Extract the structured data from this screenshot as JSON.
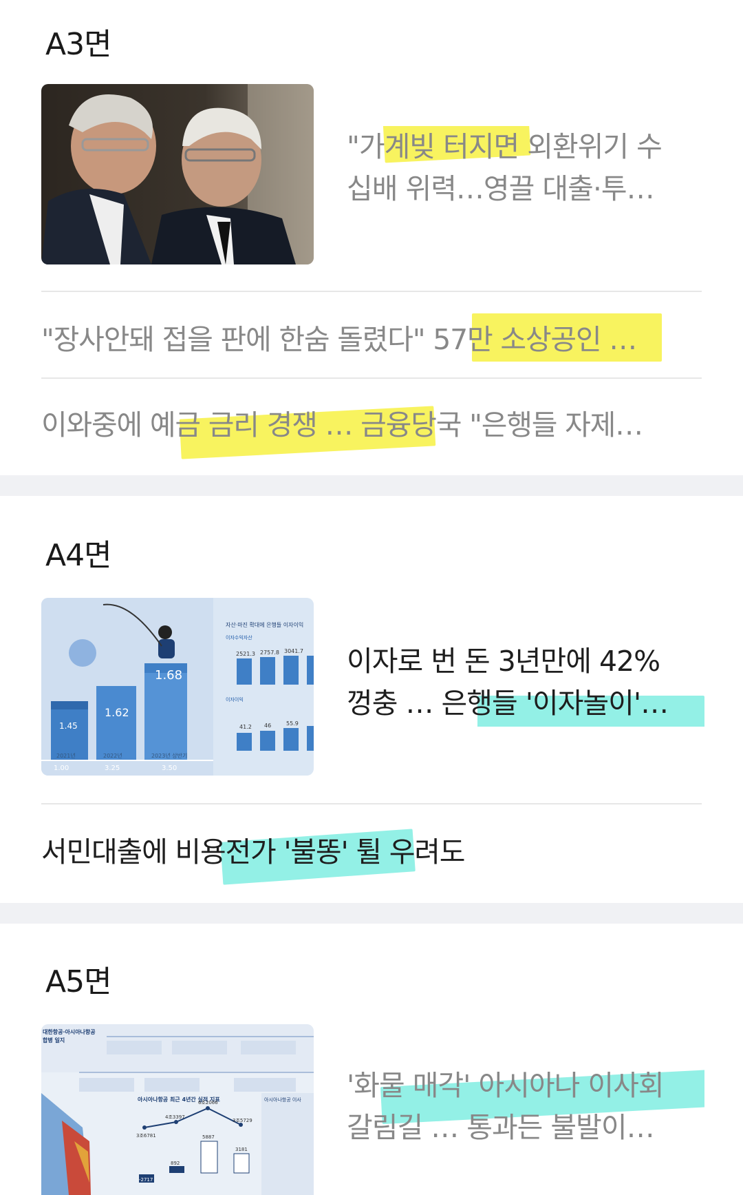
{
  "sections": [
    {
      "title": "A3면",
      "feature": {
        "headline": "\"가계빚 터지면 외환위기 수십배 위력…영끌 대출·투…",
        "line1": "\"가계빚 터지면 외환위기 수",
        "line2": "십배 위력…영끌 대출·투…"
      },
      "items": [
        "\"장사안돼 접을 판에 한숨 돌렸다\" 57만 소상공인 …",
        "이와중에 예금 금리 경쟁 … 금융당국 \"은행들 자제…"
      ]
    },
    {
      "title": "A4면",
      "feature": {
        "line1": "이자로 번 돈 3년만에 42%",
        "line2": "껑충 … 은행들 '이자놀이'…",
        "infographic": {
          "title": "자산·마진 확대에 은행들 이자이익",
          "left_labels": [
            "1.45",
            "1.62",
            "1.68"
          ],
          "bottom_labels": [
            "1.00",
            "3.25",
            "3.50"
          ],
          "years": [
            "2021년",
            "2022년",
            "2023년 상반기"
          ],
          "top_values": [
            "2521.3",
            "2757.8",
            "3041.7"
          ],
          "bottom_values": [
            "41.2",
            "46",
            "55.9"
          ],
          "label_top": "이자수익자산",
          "label_bottom": "이자이익"
        }
      },
      "items": [
        "서민대출에 비용전가 '불똥' 튈 우려도"
      ]
    },
    {
      "title": "A5면",
      "feature": {
        "line1": "'화물 매각' 아시아나 이사회",
        "line2": "갈림길 … 통과든 불발이…",
        "infographic": {
          "header": "대한항공·아시아나항공 합병 일지",
          "chart_title": "아시아나항공 최근 4년간 실적 지표",
          "values": [
            "3조6781",
            "4조3397",
            "6조2066",
            "3조5729",
            "-2717",
            "892",
            "5887",
            "3181"
          ]
        }
      },
      "items": []
    }
  ],
  "colors": {
    "highlight_yellow": "#f6f03c",
    "highlight_cyan": "#50e6d7",
    "separator": "#f0f1f4"
  }
}
